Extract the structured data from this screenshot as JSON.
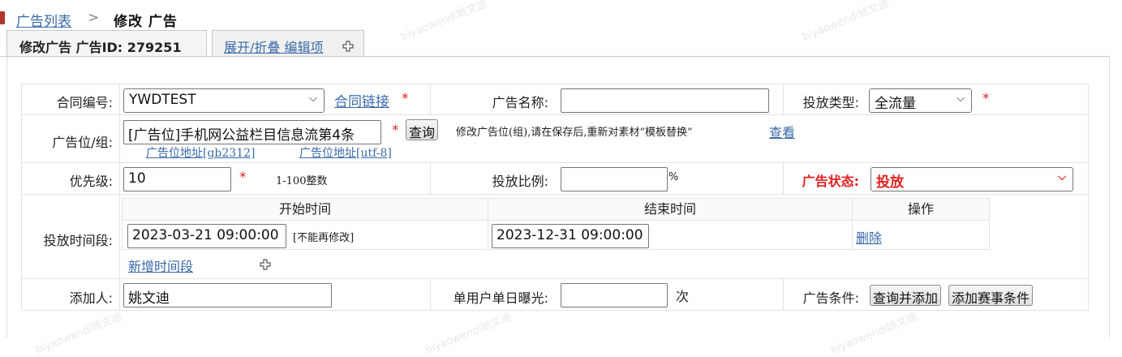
{
  "breadcrumb": {
    "parent": "广告列表",
    "separator": ">",
    "current": "修改 广告"
  },
  "tabs": [
    {
      "label": "修改广告 广告ID: 279251"
    },
    {
      "label": "展开/折叠 编辑项"
    }
  ],
  "watermark": "biyaowendi姚文迪",
  "required_mark": "*",
  "form": {
    "contract": {
      "label": "合同编号:",
      "value": "YWDTEST",
      "link": "合同链接"
    },
    "ad_name": {
      "label": "广告名称:",
      "value": ""
    },
    "delivery_type": {
      "label": "投放类型:",
      "value": "全流量"
    },
    "position": {
      "label": "广告位/组:",
      "value": "[广告位]手机网公益栏目信息流第4条",
      "query_button": "查询",
      "note": "修改广告位(组),请在保存后,重新对素材“模板替换”",
      "view_link": "查看",
      "addr_gb": "广告位地址[gb2312]",
      "addr_utf": "广告位地址[utf-8]"
    },
    "priority": {
      "label": "优先级:",
      "value": "10",
      "hint": "1-100整数"
    },
    "delivery_ratio": {
      "label": "投放比例:",
      "value": "",
      "unit": "%"
    },
    "ad_status": {
      "label": "广告状态:",
      "value": "投放",
      "color": "#e02020"
    },
    "time_slots": {
      "label": "投放时间段:",
      "col_start": "开始时间",
      "col_end": "结束时间",
      "col_action": "操作",
      "rows": [
        {
          "start": "2023-03-21 09:00:00",
          "start_note": "[不能再修改]",
          "end": "2023-12-31 09:00:00",
          "action": "删除"
        }
      ],
      "add_link": "新增时间段"
    },
    "creator": {
      "label": "添加人:",
      "value": "姚文迪"
    },
    "daily_exposure": {
      "label": "单用户单日曝光:",
      "value": "",
      "unit": "次"
    },
    "conditions": {
      "label": "广告条件:",
      "query_add_button": "查询并添加",
      "add_event_button": "添加赛事条件"
    }
  },
  "colors": {
    "link": "#3a6aa8",
    "required": "#e02020",
    "grid": "#e3e3e3"
  }
}
